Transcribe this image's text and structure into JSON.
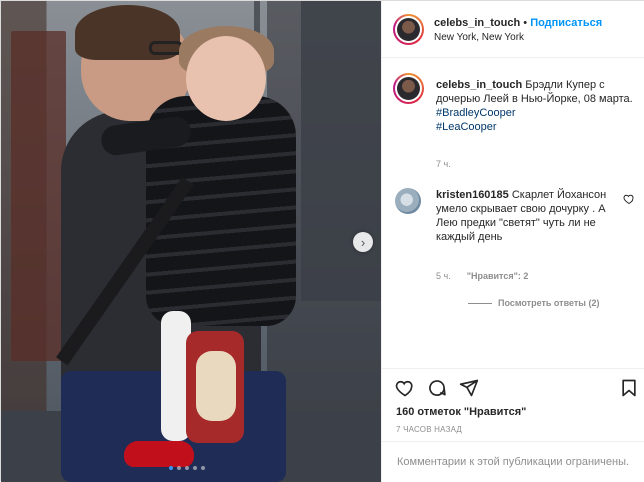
{
  "post": {
    "account": {
      "username": "celebs_in_touch",
      "separator": "•",
      "follow_label": "Подписаться",
      "location": "New York, New York"
    },
    "caption": {
      "username": "celebs_in_touch",
      "text": "Брэдли Купер с дочерью Леей в Нью-Йорке, 08 марта.",
      "hashtags": [
        "#BradleyCooper",
        "#LeaCooper"
      ],
      "time": "7 ч."
    },
    "comments": [
      {
        "username": "kristen160185",
        "text": "Скарлет Йохансон умело скрывает свою дочурку . А Лею предки \"светят\" чуть ли не каждый день",
        "time": "5 ч.",
        "likes_label": "\"Нравится\": 2",
        "replies_label": "Посмотреть ответы (2)"
      }
    ],
    "likes_text": "160 отметок \"Нравится\"",
    "posted_ago": "7 ЧАСОВ НАЗАД",
    "comments_closed": "Комментарии к этой публикации ограничены.",
    "carousel": {
      "total": 5,
      "active": 0
    }
  },
  "icons": {
    "next": "chevron-right-icon",
    "like": "heart-icon",
    "comment": "comment-icon",
    "share": "paper-plane-icon",
    "save": "bookmark-icon"
  },
  "colors": {
    "accent": "#0095f6",
    "hashtag": "#00376b",
    "muted": "#8e8e8e",
    "active_dot": "#3897f0"
  }
}
